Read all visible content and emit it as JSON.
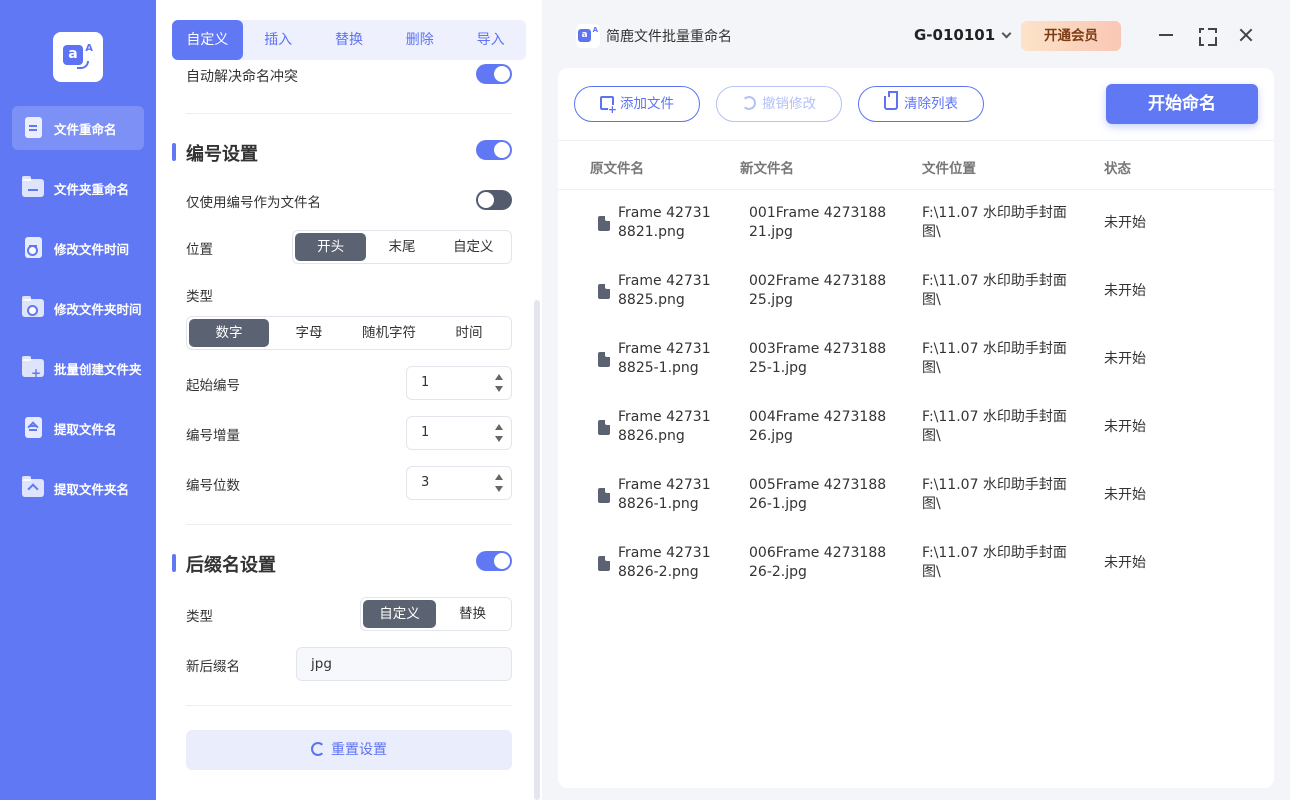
{
  "nav": {
    "items": [
      {
        "label": "文件重命名",
        "icon": "file-icon"
      },
      {
        "label": "文件夹重命名",
        "icon": "folder-icon"
      },
      {
        "label": "修改文件时间",
        "icon": "file-clock-icon"
      },
      {
        "label": "修改文件夹时间",
        "icon": "folder-clock-icon"
      },
      {
        "label": "批量创建文件夹",
        "icon": "folder-plus-icon"
      },
      {
        "label": "提取文件名",
        "icon": "file-upload-icon"
      },
      {
        "label": "提取文件夹名",
        "icon": "folder-upload-icon"
      }
    ]
  },
  "settings": {
    "tabs": [
      "自定义",
      "插入",
      "替换",
      "删除",
      "导入"
    ],
    "cutoff_label": "自动解决命名冲突",
    "numbering": {
      "title": "编号设置",
      "only_number_label": "仅使用编号作为文件名",
      "position_label": "位置",
      "position_options": [
        "开头",
        "末尾",
        "自定义"
      ],
      "type_label": "类型",
      "type_options": [
        "数字",
        "字母",
        "随机字符",
        "时间"
      ],
      "start_label": "起始编号",
      "start_value": "1",
      "increment_label": "编号增量",
      "increment_value": "1",
      "digits_label": "编号位数",
      "digits_value": "3"
    },
    "suffix": {
      "title": "后缀名设置",
      "type_label": "类型",
      "type_options": [
        "自定义",
        "替换"
      ],
      "new_suffix_label": "新后缀名",
      "new_suffix_value": "jpg"
    },
    "reset_label": "重置设置"
  },
  "topbar": {
    "app_title": "简鹿文件批量重命名",
    "account": "G-010101",
    "vip_label": "开通会员"
  },
  "toolbar": {
    "add_label": "添加文件",
    "undo_label": "撤销修改",
    "clear_label": "清除列表",
    "start_label": "开始命名"
  },
  "table": {
    "headers": [
      "原文件名",
      "新文件名",
      "文件位置",
      "状态"
    ],
    "rows": [
      {
        "original": "Frame 42731\n8821.png",
        "new": "001Frame 4273188\n21.jpg",
        "location": "F:\\11.07 水印助手封面\n图\\",
        "status": "未开始"
      },
      {
        "original": "Frame 42731\n8825.png",
        "new": "002Frame 4273188\n25.jpg",
        "location": "F:\\11.07 水印助手封面\n图\\",
        "status": "未开始"
      },
      {
        "original": "Frame 42731\n8825-1.png",
        "new": "003Frame 4273188\n25-1.jpg",
        "location": "F:\\11.07 水印助手封面\n图\\",
        "status": "未开始"
      },
      {
        "original": "Frame 42731\n8826.png",
        "new": "004Frame 4273188\n26.jpg",
        "location": "F:\\11.07 水印助手封面\n图\\",
        "status": "未开始"
      },
      {
        "original": "Frame 42731\n8826-1.png",
        "new": "005Frame 4273188\n26-1.jpg",
        "location": "F:\\11.07 水印助手封面\n图\\",
        "status": "未开始"
      },
      {
        "original": "Frame 42731\n8826-2.png",
        "new": "006Frame 4273188\n26-2.jpg",
        "location": "F:\\11.07 水印助手封面\n图\\",
        "status": "未开始"
      }
    ]
  },
  "colors": {
    "accent": "#6178f5",
    "segment_active": "#5b6272",
    "vip_text": "#7a3b12"
  }
}
